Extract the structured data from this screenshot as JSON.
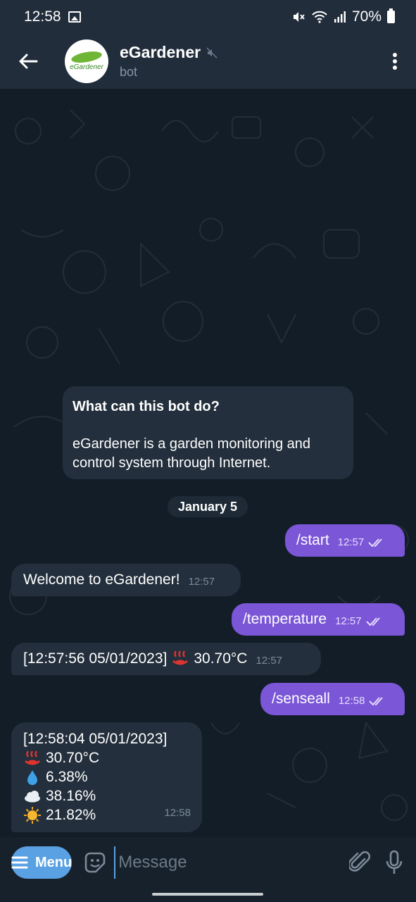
{
  "status_bar": {
    "time": "12:58",
    "battery": "70%",
    "icons": [
      "image-icon",
      "mute-icon",
      "wifi-icon",
      "signal-icon",
      "battery-icon"
    ]
  },
  "header": {
    "title": "eGardener",
    "subtitle": "bot",
    "avatar_text": "eGardener",
    "icons": [
      "back-arrow-icon",
      "muted-speaker-icon",
      "more-vert-icon"
    ]
  },
  "bot_info": {
    "title": "What can this bot do?",
    "text": "eGardener is a garden monitoring and control system through Internet."
  },
  "date_separator": "January 5",
  "messages": [
    {
      "dir": "out",
      "text": "/start",
      "time": "12:57"
    },
    {
      "dir": "in",
      "text": "Welcome to eGardener!",
      "time": "12:57"
    },
    {
      "dir": "out",
      "text": "/temperature",
      "time": "12:57"
    },
    {
      "dir": "in",
      "text": "[12:57:56 05/01/2023]",
      "value": "30.70°C",
      "time": "12:57"
    },
    {
      "dir": "out",
      "text": "/senseall",
      "time": "12:58"
    },
    {
      "dir": "in",
      "header": "[12:58:04 05/01/2023]",
      "readings": [
        {
          "icon": "hot-springs-icon",
          "value": "30.70°C"
        },
        {
          "icon": "droplet-icon",
          "value": "6.38%"
        },
        {
          "icon": "cloud-icon",
          "value": "38.16%"
        },
        {
          "icon": "sun-icon",
          "value": "21.82%"
        }
      ],
      "time": "12:58"
    }
  ],
  "input_bar": {
    "menu_label": "Menu",
    "placeholder": "Message"
  },
  "colors": {
    "header_bg": "#212d3b",
    "chat_bg": "#131d28",
    "outgoing_bubble": "#7b56d6",
    "incoming_bubble": "#232f3c",
    "menu_button": "#5aa1e3"
  }
}
